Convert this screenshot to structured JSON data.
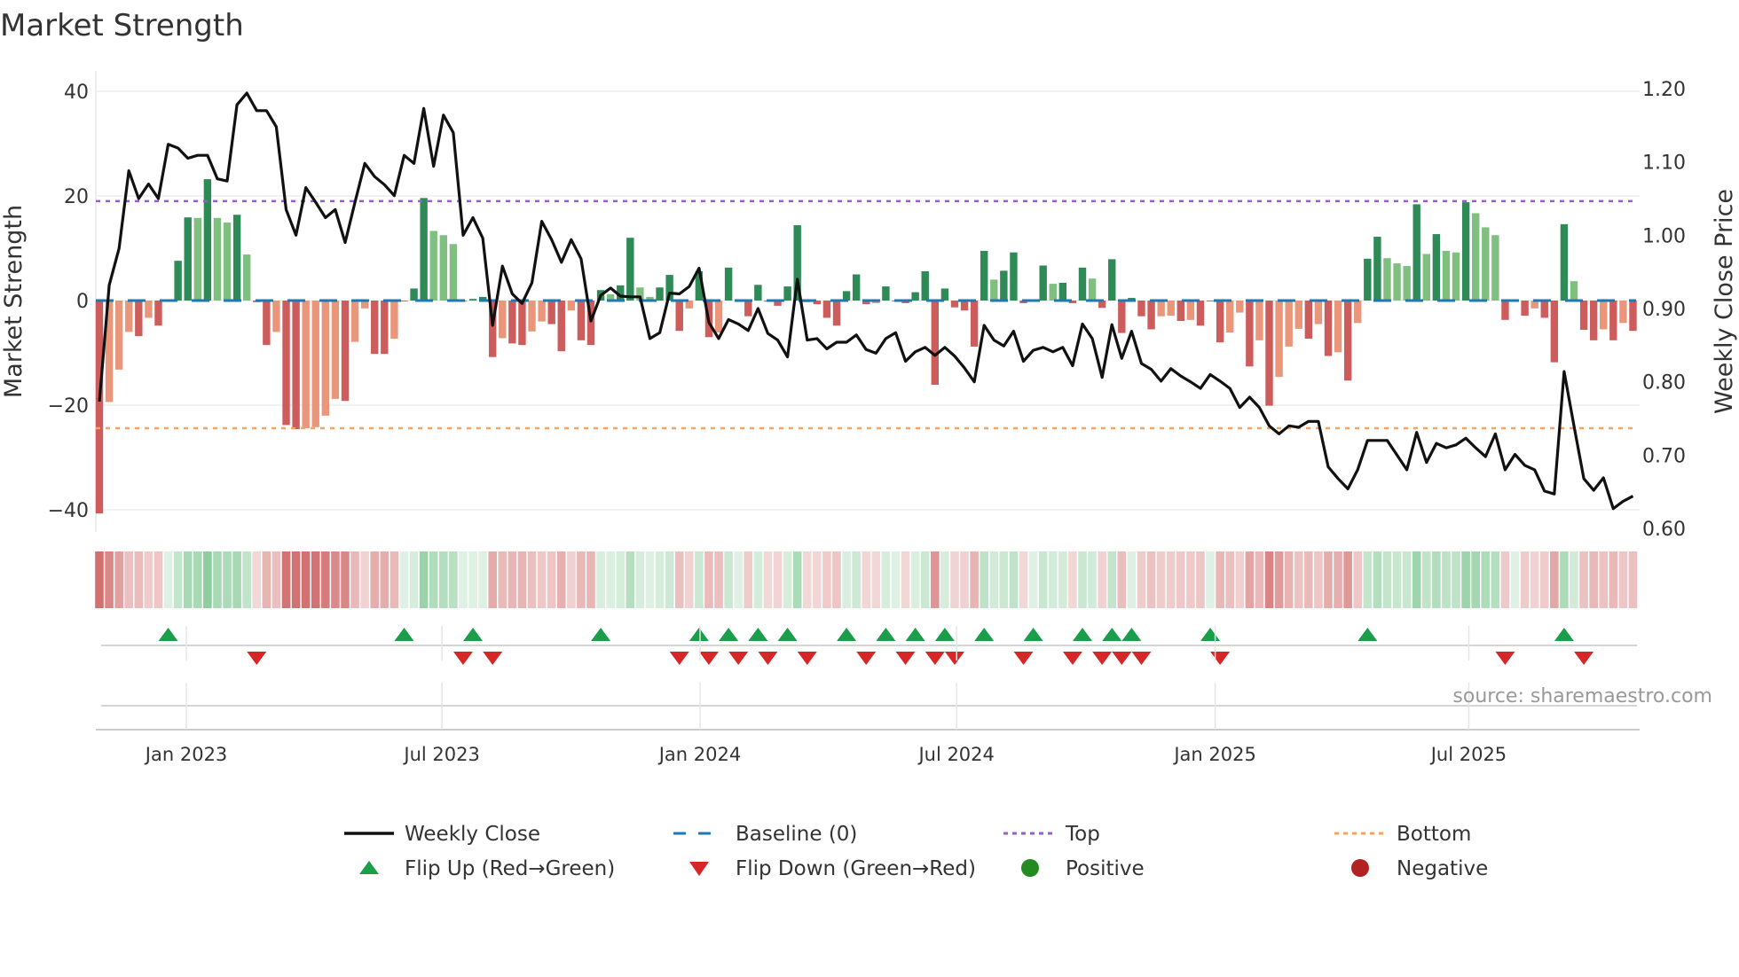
{
  "title": "Market Strength",
  "source": "source: sharemaestro.com",
  "legend": {
    "weekly_close": "Weekly Close",
    "baseline": "Baseline (0)",
    "top": "Top",
    "bottom": "Bottom",
    "flip_up": "Flip Up (Red→Green)",
    "flip_down": "Flip Down (Green→Red)",
    "positive": "Positive",
    "negative": "Negative"
  },
  "colors": {
    "pos_strong": "#2e8b57",
    "pos_weak": "#7fbf7f",
    "neg_strong": "#cd5c5c",
    "neg_weak": "#e9967a",
    "baseline": "#1f77b4",
    "top": "#9b59d6",
    "bottom": "#f4a460",
    "flip_up": "#1a9e4a",
    "flip_down": "#d62728",
    "positive": "#228b22",
    "negative": "#b22222",
    "price": "#111111"
  },
  "chart_data": {
    "type": "bar",
    "title": "Market Strength",
    "ylabel": "Market Strength",
    "y2label": "Weekly Close Price",
    "ylim": [
      -44,
      44
    ],
    "y2lim": [
      0.6,
      1.2
    ],
    "yticks": [
      "40",
      "20",
      "0",
      "−20",
      "−40"
    ],
    "ytick_values": [
      40,
      20,
      0,
      -20,
      -40
    ],
    "y2ticks": [
      "1.20",
      "1.10",
      "1.00",
      "0.90",
      "0.80",
      "0.70",
      "0.60"
    ],
    "y2tick_values": [
      1.2,
      1.1,
      1.0,
      0.9,
      0.8,
      0.7,
      0.6
    ],
    "x_unit": "week index",
    "xticks": [
      {
        "label": "Jan 2023",
        "week": 8.85
      },
      {
        "label": "Jul 2023",
        "week": 34.85
      },
      {
        "label": "Jan 2024",
        "week": 61.1
      },
      {
        "label": "Jul 2024",
        "week": 87.2
      },
      {
        "label": "Jan 2025",
        "week": 113.5
      },
      {
        "label": "Jul 2025",
        "week": 139.3
      }
    ],
    "top_level": 19,
    "bottom_level": -24.4,
    "baseline": 0,
    "strength": [
      -40.7,
      -19.4,
      -13.2,
      -6.0,
      -6.8,
      -3.3,
      -4.8,
      0,
      7.6,
      15.9,
      15.8,
      23.2,
      15.8,
      14.9,
      16.4,
      8.8,
      -0.3,
      -8.5,
      -6.0,
      -23.8,
      -24.6,
      -24.4,
      -24.2,
      -22.0,
      -18.8,
      -19.2,
      -7.9,
      -1.5,
      -10.2,
      -10.2,
      -7.3,
      0,
      2.3,
      19.6,
      13.3,
      12.5,
      10.8,
      0,
      0.3,
      0.7,
      -10.8,
      -7.2,
      -8.2,
      -8.5,
      -5.9,
      -4.0,
      -4.5,
      -9.7,
      -1.9,
      -7.6,
      -8.5,
      2.0,
      1.2,
      2.9,
      12.0,
      2.5,
      0.7,
      2.5,
      4.9,
      -5.8,
      -1.5,
      5.6,
      -7.0,
      -6.1,
      6.3,
      0,
      -3.0,
      3.0,
      -0.2,
      -1.0,
      2.7,
      14.4,
      -0.3,
      -0.7,
      -3.3,
      -4.8,
      1.8,
      5.0,
      -0.7,
      -0.5,
      2.7,
      0,
      -0.5,
      1.6,
      5.6,
      -16.1,
      2.3,
      -1.3,
      -1.9,
      -8.8,
      9.5,
      4.0,
      5.7,
      9.2,
      -0.5,
      0,
      6.7,
      3.2,
      3.4,
      -0.5,
      6.3,
      4.2,
      -1.4,
      7.9,
      -6.2,
      0.5,
      -3.0,
      -5.5,
      -3.0,
      -2.9,
      -3.9,
      -3.7,
      -4.8,
      0,
      -8.0,
      -6.1,
      -2.3,
      -12.6,
      -7.6,
      -20.1,
      -14.6,
      -8.8,
      -5.4,
      -7.3,
      -4.5,
      -10.6,
      -9.9,
      -15.3,
      -4.3,
      8.0,
      12.2,
      8.1,
      7.1,
      6.6,
      18.4,
      8.9,
      12.7,
      9.5,
      9.2,
      18.8,
      16.7,
      14.0,
      12.5,
      -3.7,
      0,
      -2.9,
      -1.5,
      -3.3,
      -11.8,
      14.6,
      3.7,
      -5.6,
      -7.6,
      -5.5,
      -7.6,
      -4.3,
      -5.8
    ],
    "weekly_close": [
      0.773,
      0.932,
      0.982,
      1.088,
      1.05,
      1.07,
      1.05,
      1.124,
      1.119,
      1.105,
      1.109,
      1.109,
      1.077,
      1.074,
      1.178,
      1.194,
      1.17,
      1.17,
      1.148,
      1.035,
      1.0,
      1.065,
      1.045,
      1.024,
      1.035,
      0.99,
      1.045,
      1.098,
      1.08,
      1.069,
      1.054,
      1.109,
      1.098,
      1.173,
      1.094,
      1.164,
      1.14,
      1.0,
      1.024,
      0.996,
      0.877,
      0.958,
      0.92,
      0.907,
      0.935,
      1.019,
      0.994,
      0.963,
      0.994,
      0.968,
      0.883,
      0.918,
      0.928,
      0.917,
      0.916,
      0.916,
      0.859,
      0.867,
      0.921,
      0.92,
      0.93,
      0.955,
      0.881,
      0.859,
      0.885,
      0.879,
      0.87,
      0.9,
      0.866,
      0.857,
      0.834,
      0.94,
      0.857,
      0.859,
      0.845,
      0.854,
      0.854,
      0.864,
      0.844,
      0.839,
      0.859,
      0.867,
      0.828,
      0.841,
      0.847,
      0.836,
      0.847,
      0.835,
      0.819,
      0.8,
      0.877,
      0.857,
      0.849,
      0.869,
      0.828,
      0.843,
      0.847,
      0.841,
      0.847,
      0.822,
      0.879,
      0.859,
      0.806,
      0.878,
      0.832,
      0.869,
      0.825,
      0.817,
      0.801,
      0.818,
      0.808,
      0.8,
      0.791,
      0.81,
      0.801,
      0.791,
      0.765,
      0.779,
      0.765,
      0.74,
      0.729,
      0.74,
      0.738,
      0.746,
      0.746,
      0.684,
      0.668,
      0.654,
      0.68,
      0.72,
      0.72,
      0.72,
      0.7,
      0.68,
      0.731,
      0.69,
      0.716,
      0.71,
      0.714,
      0.723,
      0.71,
      0.698,
      0.729,
      0.68,
      0.701,
      0.686,
      0.68,
      0.651,
      0.647,
      0.814,
      0.74,
      0.668,
      0.652,
      0.669,
      0.627,
      0.637,
      0.644
    ],
    "flip_up_weeks": [
      7,
      31,
      38,
      51,
      61,
      64,
      67,
      70,
      76,
      80,
      83,
      86,
      90,
      95,
      100,
      103,
      105,
      113,
      129,
      149
    ],
    "flip_down_weeks": [
      16,
      37,
      40,
      59,
      62,
      65,
      68,
      72,
      78,
      82,
      85,
      87,
      94,
      99,
      102,
      104,
      106,
      114,
      143,
      151
    ]
  }
}
